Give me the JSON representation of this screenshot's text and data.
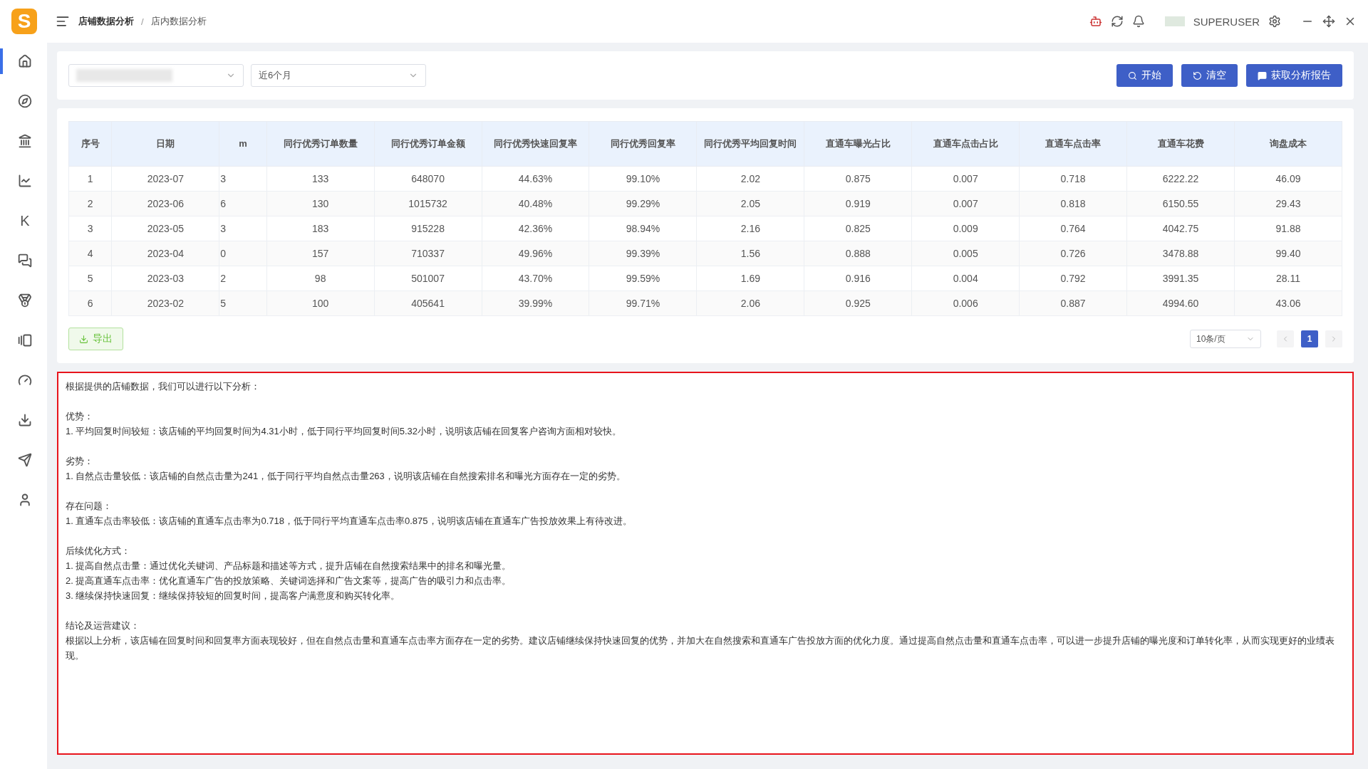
{
  "app": {
    "logo": "S"
  },
  "breadcrumb": [
    "店铺数据分析",
    "店内数据分析"
  ],
  "breadcrumb_separator": "/",
  "header": {
    "username": "SUPERUSER"
  },
  "sidebar": {
    "items": [
      {
        "kind": "icon",
        "selected": true
      },
      {
        "kind": "icon",
        "selected": false
      },
      {
        "kind": "icon",
        "selected": false
      },
      {
        "kind": "icon",
        "selected": false
      },
      {
        "kind": "letter",
        "label": "K",
        "selected": false
      },
      {
        "kind": "icon",
        "selected": false
      },
      {
        "kind": "icon",
        "selected": false
      },
      {
        "kind": "icon",
        "selected": false
      },
      {
        "kind": "icon",
        "selected": false
      },
      {
        "kind": "icon",
        "selected": false
      },
      {
        "kind": "icon",
        "selected": false
      },
      {
        "kind": "icon",
        "selected": false
      }
    ]
  },
  "filters": {
    "period": "近6个月"
  },
  "actions": [
    {
      "kind": "search",
      "label": "开始"
    },
    {
      "kind": "reset",
      "label": "清空"
    },
    {
      "kind": "report",
      "label": "获取分析报告"
    }
  ],
  "table": {
    "columns": [
      "序号",
      "日期",
      "m",
      "同行优秀订单数量",
      "同行优秀订单金额",
      "同行优秀快速回复率",
      "同行优秀回复率",
      "同行优秀平均回复时间",
      "直通车曝光占比",
      "直通车点击占比",
      "直通车点击率",
      "直通车花费",
      "询盘成本"
    ],
    "rows": [
      [
        "1",
        "2023-07",
        "3",
        "133",
        "648070",
        "44.63%",
        "99.10%",
        "2.02",
        "0.875",
        "0.007",
        "0.718",
        "6222.22",
        "46.09"
      ],
      [
        "2",
        "2023-06",
        "6",
        "130",
        "1015732",
        "40.48%",
        "99.29%",
        "2.05",
        "0.919",
        "0.007",
        "0.818",
        "6150.55",
        "29.43"
      ],
      [
        "3",
        "2023-05",
        "3",
        "183",
        "915228",
        "42.36%",
        "98.94%",
        "2.16",
        "0.825",
        "0.009",
        "0.764",
        "4042.75",
        "91.88"
      ],
      [
        "4",
        "2023-04",
        "0",
        "157",
        "710337",
        "49.96%",
        "99.39%",
        "1.56",
        "0.888",
        "0.005",
        "0.726",
        "3478.88",
        "99.40"
      ],
      [
        "5",
        "2023-03",
        "2",
        "98",
        "501007",
        "43.70%",
        "99.59%",
        "1.69",
        "0.916",
        "0.004",
        "0.792",
        "3991.35",
        "28.11"
      ],
      [
        "6",
        "2023-02",
        "5",
        "100",
        "405641",
        "39.99%",
        "99.71%",
        "2.06",
        "0.925",
        "0.006",
        "0.887",
        "4994.60",
        "43.06"
      ]
    ]
  },
  "export_button": "导出",
  "pagination": {
    "page_size": "10条/页",
    "pages": [
      {
        "label": "1",
        "selected": true
      }
    ]
  },
  "report": {
    "intro": "根据提供的店铺数据，我们可以进行以下分析：",
    "sections": [
      {
        "heading": "优势：",
        "lines": [
          "1. 平均回复时间较短：该店铺的平均回复时间为4.31小时，低于同行平均回复时间5.32小时，说明该店铺在回复客户咨询方面相对较快。"
        ]
      },
      {
        "heading": "劣势：",
        "lines": [
          "1. 自然点击量较低：该店铺的自然点击量为241，低于同行平均自然点击量263，说明该店铺在自然搜索排名和曝光方面存在一定的劣势。"
        ]
      },
      {
        "heading": "存在问题：",
        "lines": [
          "1. 直通车点击率较低：该店铺的直通车点击率为0.718，低于同行平均直通车点击率0.875，说明该店铺在直通车广告投放效果上有待改进。"
        ]
      },
      {
        "heading": "后续优化方式：",
        "lines": [
          "1. 提高自然点击量：通过优化关键词、产品标题和描述等方式，提升店铺在自然搜索结果中的排名和曝光量。",
          "2. 提高直通车点击率：优化直通车广告的投放策略、关键词选择和广告文案等，提高广告的吸引力和点击率。",
          "3. 继续保持快速回复：继续保持较短的回复时间，提高客户满意度和购买转化率。"
        ]
      },
      {
        "heading": "结论及运营建议：",
        "lines": [
          "根据以上分析，该店铺在回复时间和回复率方面表现较好，但在自然点击量和直通车点击率方面存在一定的劣势。建议店铺继续保持快速回复的优势，并加大在自然搜索和直通车广告投放方面的优化力度。通过提高自然点击量和直通车点击率，可以进一步提升店铺的曝光度和订单转化率，从而实现更好的业绩表现。"
        ]
      }
    ]
  }
}
